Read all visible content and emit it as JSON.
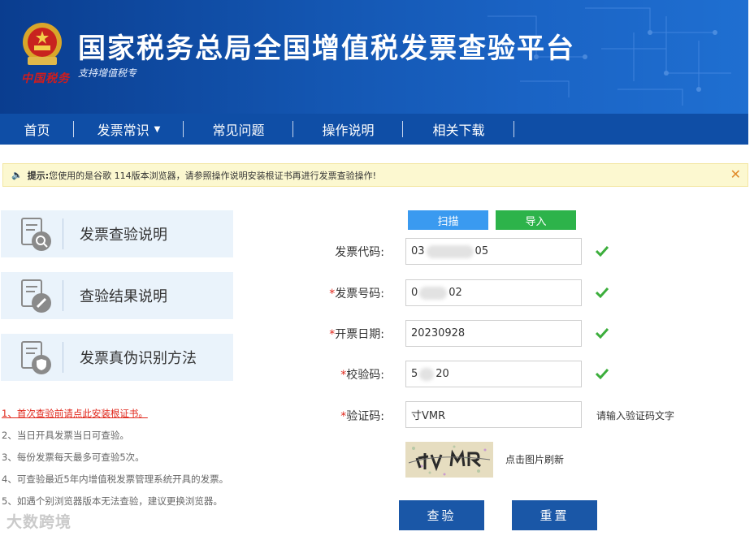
{
  "header": {
    "title": "国家税务总局全国增值税发票查验平台",
    "subtitle": "支持增值税专",
    "seal_text": "中国税务",
    "brand_color": "#1457b3"
  },
  "nav": {
    "items": [
      {
        "label": "首页"
      },
      {
        "label": "发票常识"
      },
      {
        "label": "常见问题"
      },
      {
        "label": "操作说明"
      },
      {
        "label": "相关下载"
      }
    ]
  },
  "alert": {
    "prefix": "提示:",
    "message": "您使用的是谷歌 114版本浏览器，请参照操作说明安装根证书再进行发票查验操作!"
  },
  "tiles": [
    {
      "label": "发票查验说明",
      "icon": "document-search-icon"
    },
    {
      "label": "查验结果说明",
      "icon": "document-edit-icon"
    },
    {
      "label": "发票真伪识别方法",
      "icon": "document-shield-icon"
    }
  ],
  "notes": {
    "link_note": "1、首次查验前请点此安装根证书。",
    "items": [
      "2、当日开具发票当日可查验。",
      "3、每份发票每天最多可查验5次。",
      "4、可查验最近5年内增值税发票管理系统开具的发票。",
      "5、如遇个别浏览器版本无法查验，建议更换浏览器。"
    ]
  },
  "watermark": "大数跨境",
  "form": {
    "scan_label": "扫描",
    "import_label": "导入",
    "invoice_code": {
      "label": "发票代码:",
      "prefix": "03",
      "suffix": "05"
    },
    "invoice_number": {
      "label": "发票号码:",
      "required_mark": "*",
      "prefix": "0",
      "suffix": "02"
    },
    "issue_date": {
      "label": "开票日期:",
      "required_mark": "*",
      "value": "20230928"
    },
    "check_code": {
      "label": "校验码:",
      "required_mark": "*",
      "prefix": "5",
      "suffix": "20"
    },
    "captcha": {
      "label": "验证码:",
      "required_mark": "*",
      "value": "寸VMR",
      "hint": "请输入验证码文字",
      "refresh_hint": "点击图片刷新"
    },
    "verify_button": "查验",
    "reset_button": "重置"
  }
}
